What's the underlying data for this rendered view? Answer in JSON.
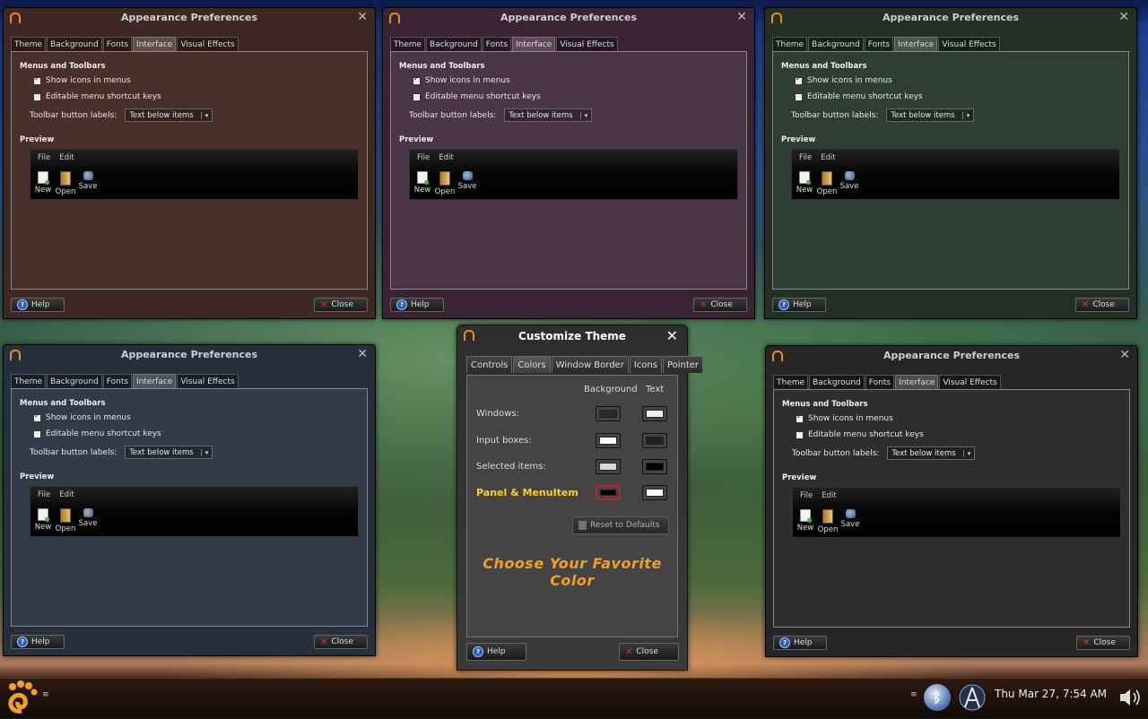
{
  "prefs": {
    "title": "Appearance Preferences",
    "tabs": [
      "Theme",
      "Background",
      "Fonts",
      "Interface",
      "Visual Effects"
    ],
    "active_tab": "Interface",
    "menus_toolbars_title": "Menus and Toolbars",
    "show_icons_label": "Show icons in menus",
    "show_icons_checked": true,
    "editable_keys_label": "Editable menu shortcut keys",
    "editable_keys_checked": false,
    "toolbar_labels_label": "Toolbar button labels:",
    "toolbar_labels_value": "Text below items",
    "preview_title": "Preview",
    "preview_menu": [
      "File",
      "Edit"
    ],
    "preview_tools": [
      "New",
      "Open",
      "Save"
    ],
    "help_label": "Help",
    "close_label": "Close"
  },
  "windows": [
    {
      "id": "top-left",
      "color": "#3f2824",
      "panel": "#4a302b"
    },
    {
      "id": "top-center",
      "color": "#3a2434",
      "panel": "#4a3648"
    },
    {
      "id": "top-right",
      "color": "#233026",
      "panel": "#2f3e33"
    },
    {
      "id": "bottom-left",
      "color": "#26303c",
      "panel": "#323c48"
    },
    {
      "id": "bottom-right",
      "color": "#262626",
      "panel": "#2e2e2e"
    }
  ],
  "customize_theme": {
    "title": "Customize Theme",
    "tabs": [
      "Controls",
      "Colors",
      "Window Border",
      "Icons",
      "Pointer"
    ],
    "active_tab": "Colors",
    "col_background": "Background",
    "col_text": "Text",
    "rows": [
      {
        "label": "Windows:",
        "bg": "#2a2a2a",
        "text": "#f0f0f0"
      },
      {
        "label": "Input boxes:",
        "bg": "#ffffff",
        "text": "#222222"
      },
      {
        "label": "Selected items:",
        "bg": "#d8d8d8",
        "text": "#000000"
      },
      {
        "label": "Panel & MenuItem",
        "bg": "#000000",
        "text": "#ffffff",
        "highlight": "#ffd21a"
      }
    ],
    "reset_label": "Reset to Defaults",
    "tagline": "Choose Your Favorite Color",
    "help_label": "Help",
    "close_label": "Close"
  },
  "taskbar": {
    "clock": "Thu Mar 27,  7:54 AM",
    "menu_grip": "≡"
  }
}
